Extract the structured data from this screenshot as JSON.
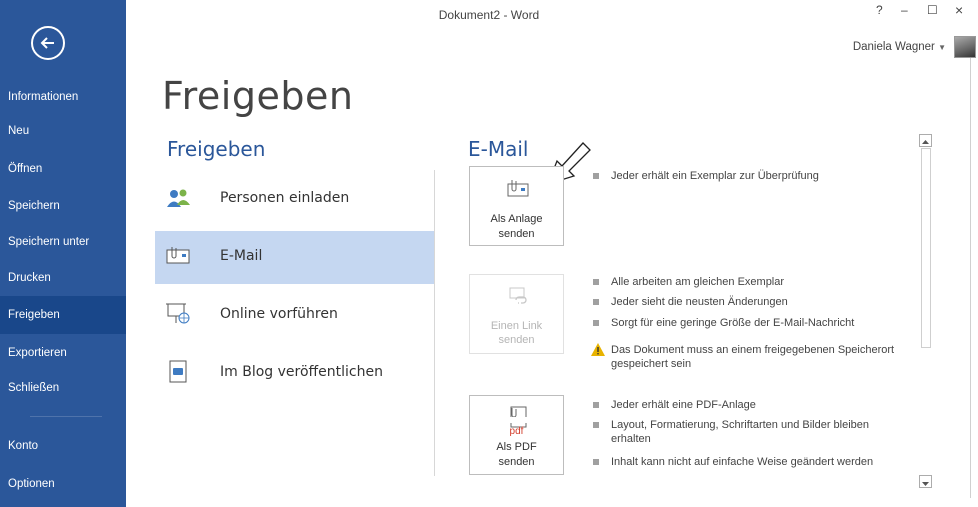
{
  "window": {
    "title": "Dokument2 - Word",
    "controls": {
      "help": "?",
      "minimize": "–",
      "maximize": "☐",
      "close": "×"
    },
    "user_name": "Daniela Wagner"
  },
  "sidebar": {
    "items": [
      {
        "label": "Informationen"
      },
      {
        "label": "Neu"
      },
      {
        "label": "Öffnen"
      },
      {
        "label": "Speichern"
      },
      {
        "label": "Speichern unter"
      },
      {
        "label": "Drucken"
      },
      {
        "label": "Freigeben"
      },
      {
        "label": "Exportieren"
      },
      {
        "label": "Schließen"
      },
      {
        "label": "Konto"
      },
      {
        "label": "Optionen"
      }
    ],
    "active_index": 6
  },
  "main": {
    "page_title": "Freigeben",
    "section_title": "Freigeben",
    "share_items": [
      {
        "label": "Personen einladen",
        "icon": "people-icon"
      },
      {
        "label": "E-Mail",
        "icon": "email-icon"
      },
      {
        "label": "Online vorführen",
        "icon": "present-online-icon"
      },
      {
        "label": "Im Blog veröffentlichen",
        "icon": "blog-icon"
      }
    ],
    "active_share_index": 1
  },
  "email": {
    "title": "E-Mail",
    "options": [
      {
        "label_line1": "Als Anlage",
        "label_line2": "senden",
        "icon": "attachment-mail-icon",
        "enabled": true,
        "bullets": [
          "Jeder erhält ein Exemplar zur Überprüfung"
        ]
      },
      {
        "label_line1": "Einen Link",
        "label_line2": "senden",
        "icon": "link-mail-icon",
        "enabled": false,
        "bullets": [
          "Alle arbeiten am gleichen Exemplar",
          "Jeder sieht die neusten Änderungen",
          "Sorgt für eine geringe Größe der E-Mail-Nachricht"
        ],
        "warning": "Das Dokument muss an einem freigegebenen Speicherort gespeichert sein"
      },
      {
        "label_line1": "Als PDF",
        "label_line2": "senden",
        "icon": "pdf-mail-icon",
        "enabled": true,
        "bullets": [
          "Jeder erhält eine PDF-Anlage",
          "Layout, Formatierung, Schriftarten und Bilder bleiben erhalten",
          "Inhalt kann nicht auf einfache Weise geändert werden"
        ]
      }
    ]
  },
  "colors": {
    "sidebar": "#2b579a",
    "sidebar_active": "#19478a",
    "accent_text": "#2b579a",
    "selected_item": "#c5d7f1"
  }
}
